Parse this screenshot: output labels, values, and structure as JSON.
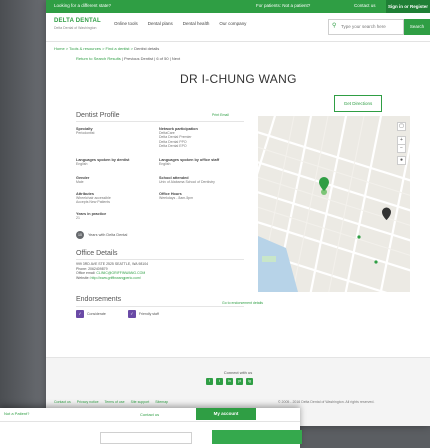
{
  "utilbar": {
    "left_link": "Looking for a different state?",
    "patients": "For patients: Not a patient?",
    "contact": "Contact us",
    "signin": "Sign in or Register"
  },
  "header": {
    "logo": "DELTA DENTAL",
    "logo_sub": "Delta Dental of Washington",
    "nav": [
      "Online tools",
      "Dental plans",
      "Dental health",
      "Our company"
    ],
    "search_placeholder": "Type your search here",
    "search_button": "Search"
  },
  "breadcrumb": {
    "items": [
      "Home",
      "Tools & resources",
      "Find a dentist",
      "Dentist details"
    ]
  },
  "back_link": {
    "link": "Return to Search Results",
    "text": "| Previous Dentist | 6 of 50 | Next"
  },
  "page_title": "DR I-CHUNG WANG",
  "directions_button": "Get Directions",
  "profile": {
    "heading": "Dentist Profile",
    "print_link": "Print  Email",
    "specialty": {
      "label": "Specialty",
      "value": "Periodontist"
    },
    "network": {
      "label": "Network participation",
      "lines": [
        "DeltaCare",
        "Delta Dental Premier",
        "Delta Dental PPO",
        "Delta Dental EPO"
      ]
    },
    "languages_dentist": {
      "label": "Languages spoken by dentist",
      "value": "English"
    },
    "languages_staff": {
      "label": "Languages spoken by office staff",
      "value": "English"
    },
    "gender": {
      "label": "Gender",
      "value": "Male"
    },
    "school": {
      "label": "School attended",
      "value": "Univ of Alabama School of Dentistry"
    },
    "attributes": {
      "label": "Attributes",
      "lines": [
        "Wheelchair accessible",
        "Accepts New Patients"
      ]
    },
    "office_hours": {
      "label": "Office Hours",
      "value": "Weekdays - 8am-5pm"
    },
    "years_practice": {
      "label": "Years in practice",
      "value": "21"
    },
    "years_badge": "10",
    "years_text": "Years with Delta Dental"
  },
  "office": {
    "heading": "Office Details",
    "address": "999 3RD AVE STE 2525 SEATTLE, WA 98104",
    "phone": "Phone: 2062409879",
    "email_label": "Office email:",
    "email": "CLINIC@GRIFFINWANG.COM",
    "website_label": "Website:",
    "website": "http://www.griffinwangperio.com/"
  },
  "endorsements": {
    "heading": "Endorsements",
    "link": "Go to endorsement details",
    "items": [
      "Considerate",
      "Friendly staff"
    ]
  },
  "footer": {
    "connect": "Connect with us",
    "social": [
      "f",
      "t",
      "in",
      "yt",
      "ig"
    ],
    "links": [
      "Contact us",
      "Privacy notice",
      "Terms of use",
      "Site support",
      "Sitemap"
    ],
    "copyright": "© 2005 - 2016 Delta Dental of Washington. All rights reserved."
  },
  "second_window": {
    "who": "Not a Patient?",
    "contact": "Contact us",
    "account": "My account"
  },
  "colors": {
    "brand_green": "#2f9e44",
    "endorse_purple": "#6a4aa6"
  }
}
